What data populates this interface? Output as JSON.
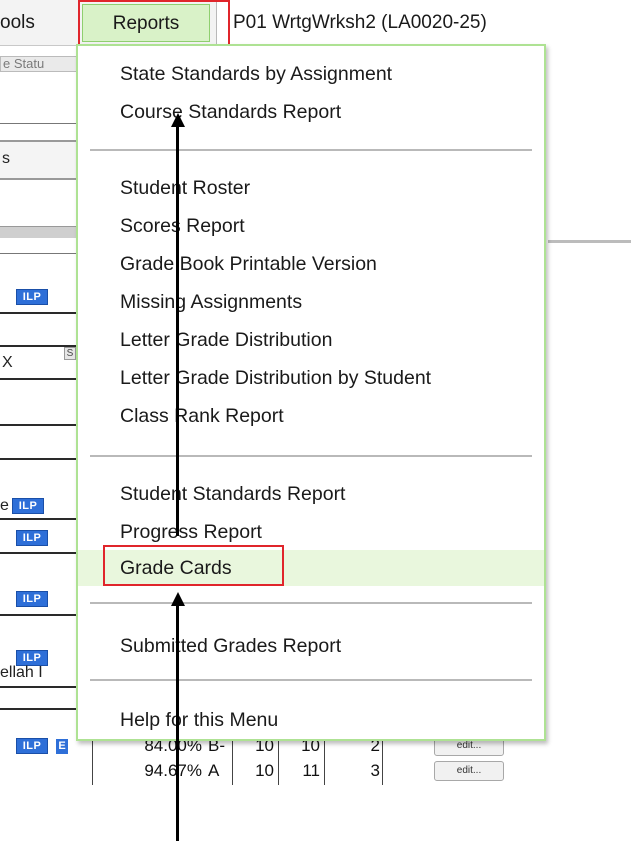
{
  "menubar": {
    "tools_label": "ools",
    "reports_label": "Reports",
    "course_title": "P01  WrtgWrksh2 (LA0020-25)"
  },
  "background": {
    "tab_fragment": "e Statu",
    "s_fragment": "s",
    "ilp_label": "ILP",
    "s_badge": "S",
    "x_fragment": "X",
    "e_fragment": "e",
    "name_fragment": "ellah I",
    "e_badge": "E"
  },
  "table": {
    "rows": [
      {
        "percent": "84.00%",
        "grade": "B-",
        "c1": "10",
        "c2": "10",
        "c3": "2",
        "edit": "edit..."
      },
      {
        "percent": "94.67%",
        "grade": "A",
        "c1": "10",
        "c2": "11",
        "c3": "3",
        "edit": "edit..."
      }
    ]
  },
  "dropdown": {
    "items": [
      "State Standards by Assignment",
      "Course Standards Report",
      "Student Roster",
      "Scores Report",
      "Grade Book Printable Version",
      "Missing Assignments",
      "Letter Grade Distribution",
      "Letter Grade Distribution by Student",
      "Class Rank Report",
      "Student Standards Report",
      "Progress Report",
      "Grade Cards",
      "Submitted Grades Report",
      "Help for this Menu"
    ],
    "active_item": "Grade Cards"
  },
  "colors": {
    "highlight_box": "#e0252b",
    "menu_border": "#aee293",
    "active_bg": "#e9f7dd",
    "ilp_badge": "#2e6fd8"
  }
}
